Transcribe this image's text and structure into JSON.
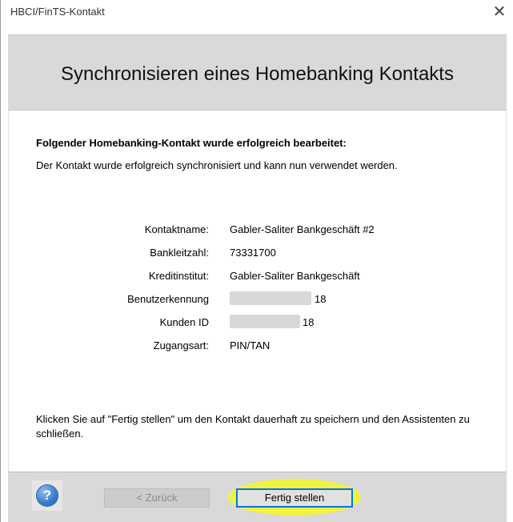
{
  "window": {
    "title": "HBCI/FinTS-Kontakt",
    "close_glyph": "✕"
  },
  "header": {
    "title": "Synchronisieren eines Homebanking Kontakts"
  },
  "content": {
    "heading": "Folgender Homebanking-Kontakt wurde erfolgreich bearbeitet:",
    "message": "Der Kontakt wurde erfolgreich synchronisiert und kann nun verwendet werden.",
    "details": [
      {
        "label": "Kontaktname:",
        "value": "Gabler-Saliter Bankgeschäft #2"
      },
      {
        "label": "Bankleitzahl:",
        "value": "73331700"
      },
      {
        "label": "Kreditinstitut:",
        "value": "Gabler-Saliter Bankgeschäft"
      },
      {
        "label": "Benutzerkennung",
        "value": "18"
      },
      {
        "label": "Kunden ID",
        "value": "18"
      },
      {
        "label": "Zugangsart:",
        "value": "PIN/TAN"
      }
    ],
    "footer": "Klicken Sie auf \"Fertig stellen\" um den Kontakt dauerhaft zu speichern und den Assistenten zu schließen."
  },
  "buttons": {
    "help_glyph": "?",
    "back_label": "< Zurück",
    "finish_label": "Fertig stellen"
  },
  "colors": {
    "header_band": "#d9d9d9",
    "focus_border": "#0078d7",
    "highlight": "#f6f628"
  }
}
